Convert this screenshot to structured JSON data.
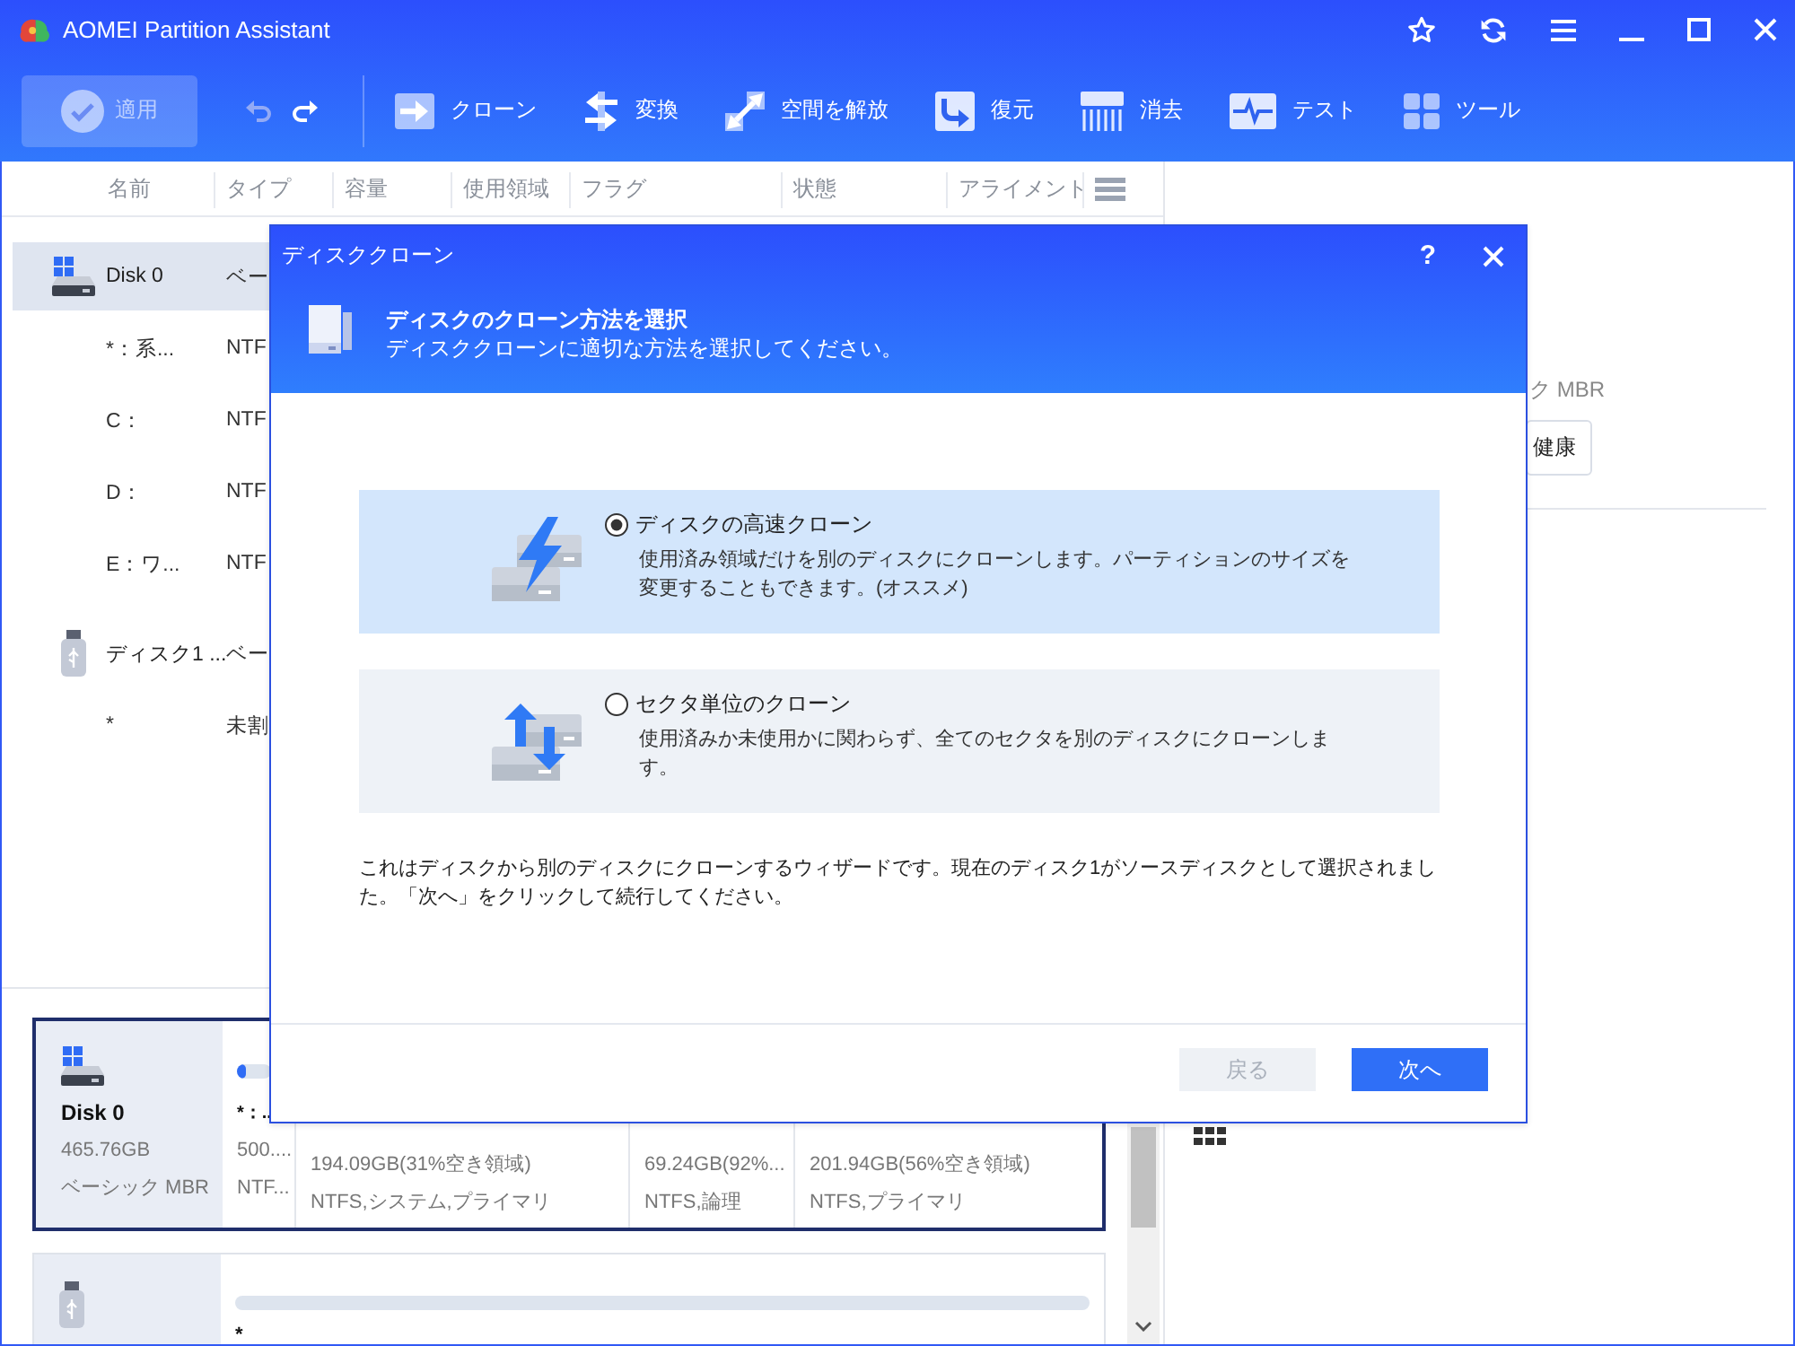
{
  "window": {
    "title": "AOMEI Partition Assistant"
  },
  "toolbar": {
    "apply": {
      "label": "適用",
      "disabled": true
    },
    "history": [
      {
        "kind": "undo",
        "disabled": true
      },
      {
        "kind": "redo",
        "disabled": false
      }
    ],
    "tools": [
      {
        "label": "クローン"
      },
      {
        "label": "変換"
      },
      {
        "label": "空間を解放"
      },
      {
        "label": "復元"
      },
      {
        "label": "消去"
      },
      {
        "label": "テスト"
      },
      {
        "label": "ツール"
      }
    ]
  },
  "table": {
    "columns": [
      "名前",
      "タイプ",
      "容量",
      "使用領域",
      "フラグ",
      "状態",
      "アライメント"
    ],
    "rows": [
      {
        "kind": "system-disk",
        "name": "Disk 0",
        "type": "ベー",
        "selected": true
      },
      {
        "kind": "partition",
        "name": "*：系...",
        "type": "NTF",
        "selected": false
      },
      {
        "kind": "partition",
        "name": "C：",
        "type": "NTF",
        "selected": false
      },
      {
        "kind": "partition",
        "name": "D：",
        "type": "NTF",
        "selected": false
      },
      {
        "kind": "partition",
        "name": "E：ワ...",
        "type": "NTF",
        "selected": false
      },
      {
        "kind": "usb-disk",
        "name": "ディスク1 ...",
        "type": "ベー",
        "selected": false
      },
      {
        "kind": "partition",
        "name": "*",
        "type": "未割",
        "selected": false
      }
    ]
  },
  "disk_panel": {
    "type_text": "ク MBR",
    "health_button": "健康"
  },
  "disk_map": {
    "disks": [
      {
        "kind": "system-disk",
        "name": "Disk 0",
        "size": "465.76GB",
        "style": "ベーシック MBR",
        "selected": true,
        "partitions": [
          {
            "label": "*：..",
            "level": 0.25,
            "size": "500....",
            "detail": "NTF..."
          },
          {
            "size": "194.09GB(31%空き領域)",
            "detail": "NTFS,システム,プライマリ"
          },
          {
            "size": "69.24GB(92%...",
            "detail": "NTFS,論理"
          },
          {
            "size": "201.94GB(56%空き領域)",
            "detail": "NTFS,プライマリ"
          }
        ]
      },
      {
        "kind": "usb-disk",
        "selected": false,
        "partitions": [
          {
            "label": "*"
          }
        ]
      }
    ]
  },
  "dialog": {
    "title": "ディスククローン",
    "help_label": "?",
    "heading": "ディスクのクローン方法を選択",
    "subheading": "ディスククローンに適切な方法を選択してください。",
    "options": [
      {
        "kind": "fast",
        "label": "ディスクの高速クローン",
        "description": "使用済み領域だけを別のディスクにクローンします。パーティションのサイズを変更することもできます。(オススメ)",
        "selected": true
      },
      {
        "kind": "sector",
        "label": "セクタ単位のクローン",
        "description": "使用済みか未使用かに関わらず、全てのセクタを別のディスクにクローンします。",
        "selected": false
      }
    ],
    "note": "これはディスクから別のディスクにクローンするウィザードです。現在のディスク1がソースディスクとして選択されました。「次へ」をクリックして続行してください。",
    "buttons": [
      {
        "kind": "secondary",
        "label": "戻る",
        "disabled": true
      },
      {
        "kind": "primary",
        "label": "次へ",
        "disabled": false
      }
    ]
  }
}
